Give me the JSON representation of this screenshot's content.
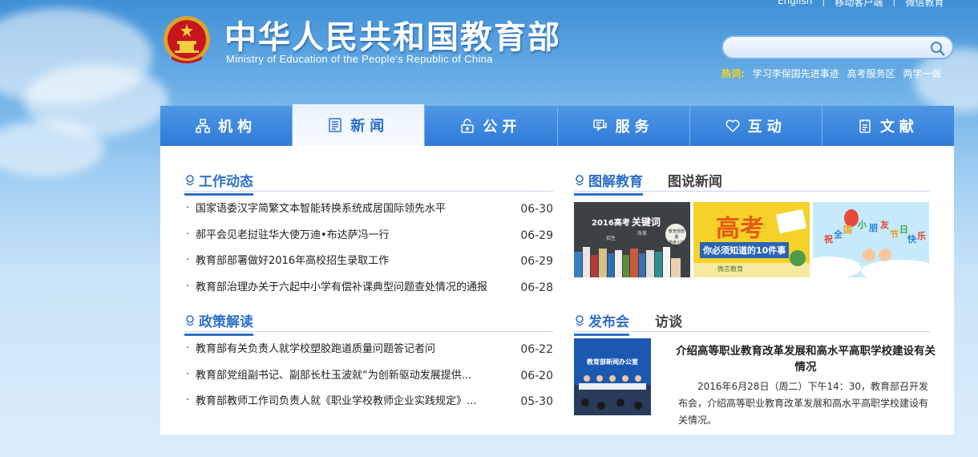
{
  "header": {
    "title_cn": "中华人民共和国教育部",
    "title_en": "Ministry of Education of the People's Republic of China",
    "top_links": [
      "English",
      "移动客户端",
      "微信教育"
    ],
    "search": {
      "placeholder": "",
      "value": ""
    },
    "hot_label": "热词:",
    "hot_items": [
      "学习李保国先进事迹",
      "高考服务区",
      "两学一做"
    ]
  },
  "nav": {
    "items": [
      {
        "label": "机构",
        "icon": "org-icon"
      },
      {
        "label": "新闻",
        "icon": "news-icon",
        "active": true
      },
      {
        "label": "公开",
        "icon": "lock-icon"
      },
      {
        "label": "服务",
        "icon": "service-icon"
      },
      {
        "label": "互动",
        "icon": "heart-icon"
      },
      {
        "label": "文献",
        "icon": "document-icon"
      }
    ]
  },
  "work": {
    "title": "工作动态",
    "items": [
      {
        "title": "国家语委汉字简繁文本智能转换系统成居国际领先水平",
        "date": "06-30"
      },
      {
        "title": "郝平会见老挝驻华大使万迪•布达萨冯一行",
        "date": "06-29"
      },
      {
        "title": "教育部部署做好2016年高校招生录取工作",
        "date": "06-29"
      },
      {
        "title": "教育部治理办关于六起中小学有偿补课典型问题查处情况的通报",
        "date": "06-28"
      }
    ]
  },
  "policy": {
    "title": "政策解读",
    "items": [
      {
        "title": "教育部有关负责人就学校塑胶跑道质量问题答记者问",
        "date": "06-22"
      },
      {
        "title": "教育部党组副书记、副部长杜玉波就“为创新驱动发展提供...",
        "date": "06-20"
      },
      {
        "title": "教育部教师工作司负责人就《职业学校教师企业实践规定》...",
        "date": "05-30"
      }
    ]
  },
  "graphic": {
    "tab_active": "图解教育",
    "tab_other": "图说新闻",
    "thumbs": [
      {
        "year": "2016高考",
        "word": "关键词",
        "small1": "教育部部署",
        "small2": "高考小锦囊",
        "small3": "改革",
        "small4": "招生"
      },
      {
        "big": "高考",
        "banner": "你必须知道的10件事",
        "brand": "微言教育"
      },
      {
        "text": "祝全国小朋友节日快乐",
        "chars": [
          "祝",
          "全",
          "国",
          "小",
          "朋",
          "友",
          "节",
          "日",
          "快",
          "乐"
        ]
      }
    ]
  },
  "release": {
    "tab_active": "发布会",
    "tab_other": "访谈",
    "image_caption": "教育部新闻办公室",
    "title": "介绍高等职业教育改革发展和高水平高职学校建设有关情况",
    "body": "2016年6月28日（周二）下午14：30，教育部召开发布会，介绍高等职业教育改革发展和高水平高职学校建设有关情况。"
  },
  "colors": {
    "nav_blue": "#3a86de",
    "accent_blue": "#2f6fc9",
    "hot_yellow": "#f7d21e"
  }
}
